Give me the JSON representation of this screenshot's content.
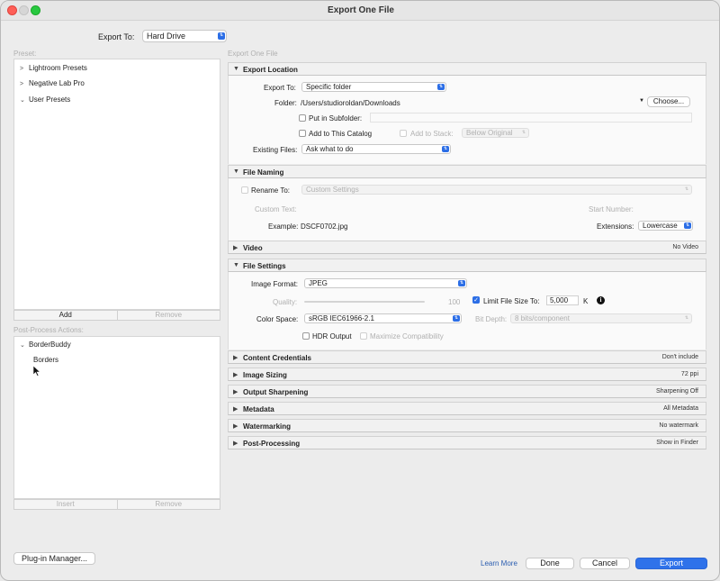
{
  "window": {
    "title": "Export One File"
  },
  "export_to": {
    "label": "Export To:",
    "value": "Hard Drive"
  },
  "preset": {
    "label": "Preset:",
    "items": [
      {
        "label": "Lightroom Presets",
        "expanded": false
      },
      {
        "label": "Negative Lab Pro",
        "expanded": false
      },
      {
        "label": "User Presets",
        "expanded": true
      }
    ],
    "add_label": "Add",
    "remove_label": "Remove"
  },
  "post_process": {
    "label": "Post-Process Actions:",
    "group": "BorderBuddy",
    "child": "Borders",
    "insert_label": "Insert",
    "remove_label": "Remove"
  },
  "panel_header": "Export One File",
  "sections": {
    "export_location": {
      "title": "Export Location",
      "export_to_label": "Export To:",
      "export_to_value": "Specific folder",
      "folder_label": "Folder:",
      "folder_value": "/Users/studioroldan/Downloads",
      "choose_label": "Choose...",
      "subfolder_label": "Put in Subfolder:",
      "add_catalog_label": "Add to This Catalog",
      "add_stack_label": "Add to Stack:",
      "stack_value": "Below Original",
      "existing_label": "Existing Files:",
      "existing_value": "Ask what to do"
    },
    "file_naming": {
      "title": "File Naming",
      "rename_label": "Rename To:",
      "rename_value": "Custom Settings",
      "custom_text_label": "Custom Text:",
      "start_number_label": "Start Number:",
      "example_label": "Example:",
      "example_value": "DSCF0702.jpg",
      "extensions_label": "Extensions:",
      "extensions_value": "Lowercase"
    },
    "video": {
      "title": "Video",
      "summary": "No Video"
    },
    "file_settings": {
      "title": "File Settings",
      "format_label": "Image Format:",
      "format_value": "JPEG",
      "quality_label": "Quality:",
      "quality_value": "100",
      "limit_label": "Limit File Size To:",
      "limit_value": "5,000",
      "limit_unit": "K",
      "color_space_label": "Color Space:",
      "color_space_value": "sRGB IEC61966-2.1",
      "bit_depth_label": "Bit Depth:",
      "bit_depth_value": "8 bits/component",
      "hdr_label": "HDR Output",
      "maximize_label": "Maximize Compatibility"
    },
    "collapsed": [
      {
        "title": "Content Credentials",
        "summary": "Don't include"
      },
      {
        "title": "Image Sizing",
        "summary": "72 ppi"
      },
      {
        "title": "Output Sharpening",
        "summary": "Sharpening Off"
      },
      {
        "title": "Metadata",
        "summary": "All Metadata"
      },
      {
        "title": "Watermarking",
        "summary": "No watermark"
      },
      {
        "title": "Post-Processing",
        "summary": "Show in Finder"
      }
    ]
  },
  "footer": {
    "plugin_manager": "Plug-in Manager...",
    "learn_more": "Learn More",
    "done": "Done",
    "cancel": "Cancel",
    "export": "Export"
  },
  "colors": {
    "accent": "#2f72ea",
    "link": "#2a5db0"
  }
}
